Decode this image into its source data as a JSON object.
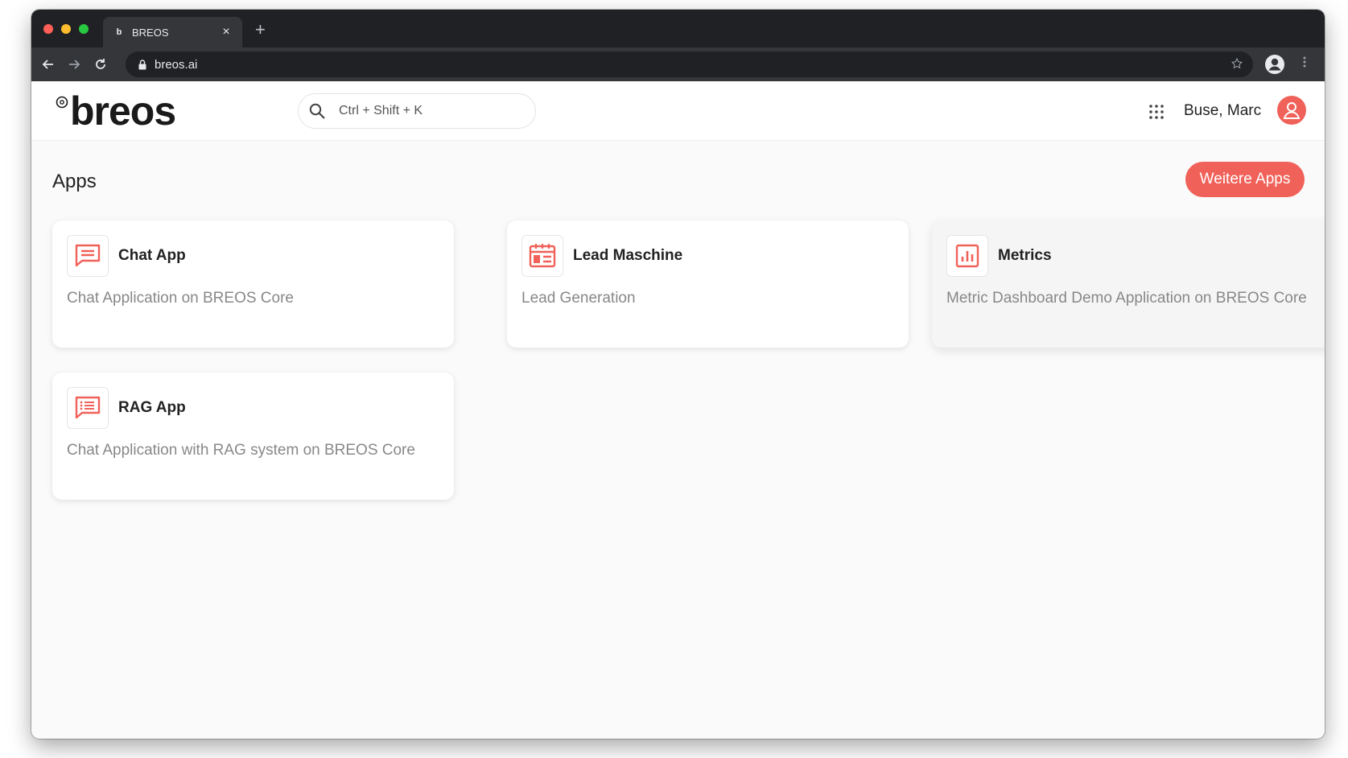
{
  "browser": {
    "tab_title": "BREOS",
    "tab_favicon_letter": "b",
    "tab_close": "×",
    "new_tab": "+",
    "url": "breos.ai"
  },
  "header": {
    "logo_text": "breos",
    "search_placeholder": "Ctrl + Shift + K",
    "user_name": "Buse, Marc"
  },
  "page": {
    "title": "Apps",
    "more_apps_label": "Weitere Apps"
  },
  "apps": [
    {
      "title": "Chat App",
      "description": "Chat Application on BREOS Core",
      "icon": "chat-icon"
    },
    {
      "title": "Lead Maschine",
      "description": "Lead Generation",
      "icon": "calendar-icon"
    },
    {
      "title": "Metrics",
      "description": "Metric Dashboard Demo Application on BREOS Core",
      "icon": "chart-icon"
    },
    {
      "title": "RAG App",
      "description": "Chat Application with RAG system on BREOS Core",
      "icon": "list-chat-icon"
    }
  ],
  "colors": {
    "accent": "#f06159",
    "browser_dark": "#202124",
    "browser_toolbar": "#35363a"
  }
}
